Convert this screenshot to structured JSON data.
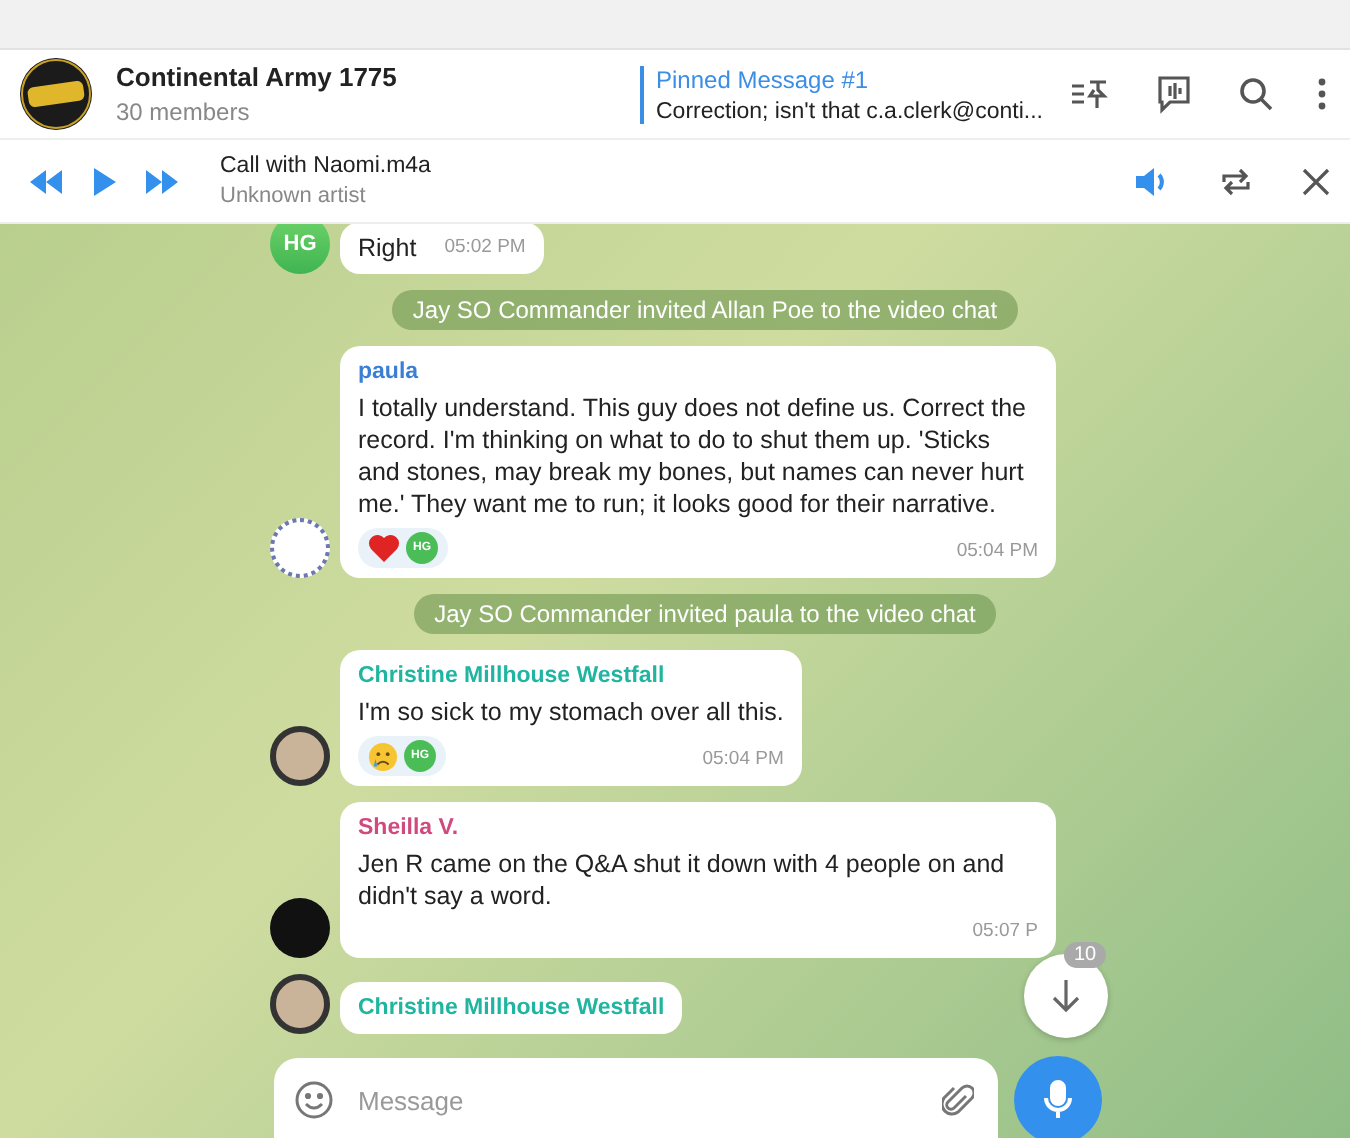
{
  "header": {
    "title": "Continental Army 1775",
    "subtitle": "30 members",
    "pinned": {
      "label": "Pinned Message #1",
      "text": "Correction; isn't that c.a.clerk@conti..."
    }
  },
  "player": {
    "title": "Call with Naomi.m4a",
    "artist": "Unknown artist",
    "repeat": false
  },
  "messages": [
    {
      "kind": "message",
      "avatar": {
        "kind": "initials",
        "initials": "HG"
      },
      "text": "Right",
      "time": "05:02 PM"
    },
    {
      "kind": "service",
      "text": "Jay SO Commander invited Allan Poe to the video chat"
    },
    {
      "kind": "message",
      "avatar": {
        "kind": "pattern"
      },
      "sender": "paula",
      "color": "#3a7fd5",
      "text": "I totally understand. This guy does not define us. Correct the record. I'm thinking on what to do to shut them up. 'Sticks and stones, may break my bones, but names can never hurt me.' They want me to run; it looks good for their narrative.",
      "time": "05:04 PM",
      "reactions": [
        {
          "kind": "heart",
          "reactor": "HG"
        }
      ]
    },
    {
      "kind": "service",
      "text": "Jay SO Commander invited paula to the video chat"
    },
    {
      "kind": "message",
      "avatar": {
        "kind": "photo"
      },
      "sender": "Christine Millhouse Westfall",
      "color": "#1fb5a0",
      "text": "I'm so sick to my stomach over all this.",
      "time": "05:04 PM",
      "reactions": [
        {
          "kind": "cry",
          "reactor": "HG"
        }
      ]
    },
    {
      "kind": "message",
      "avatar": {
        "kind": "dark"
      },
      "sender": "Sheilla V.",
      "color": "#d04a7e",
      "text": "Jen R came on the Q&A shut it down with 4 people on and didn't say a word.",
      "time": "05:07 P"
    },
    {
      "kind": "message",
      "avatar": {
        "kind": "photo"
      },
      "sender": "Christine Millhouse Westfall",
      "color": "#1fb5a0"
    }
  ],
  "scroll_badge": "10",
  "composer": {
    "placeholder": "Message"
  }
}
